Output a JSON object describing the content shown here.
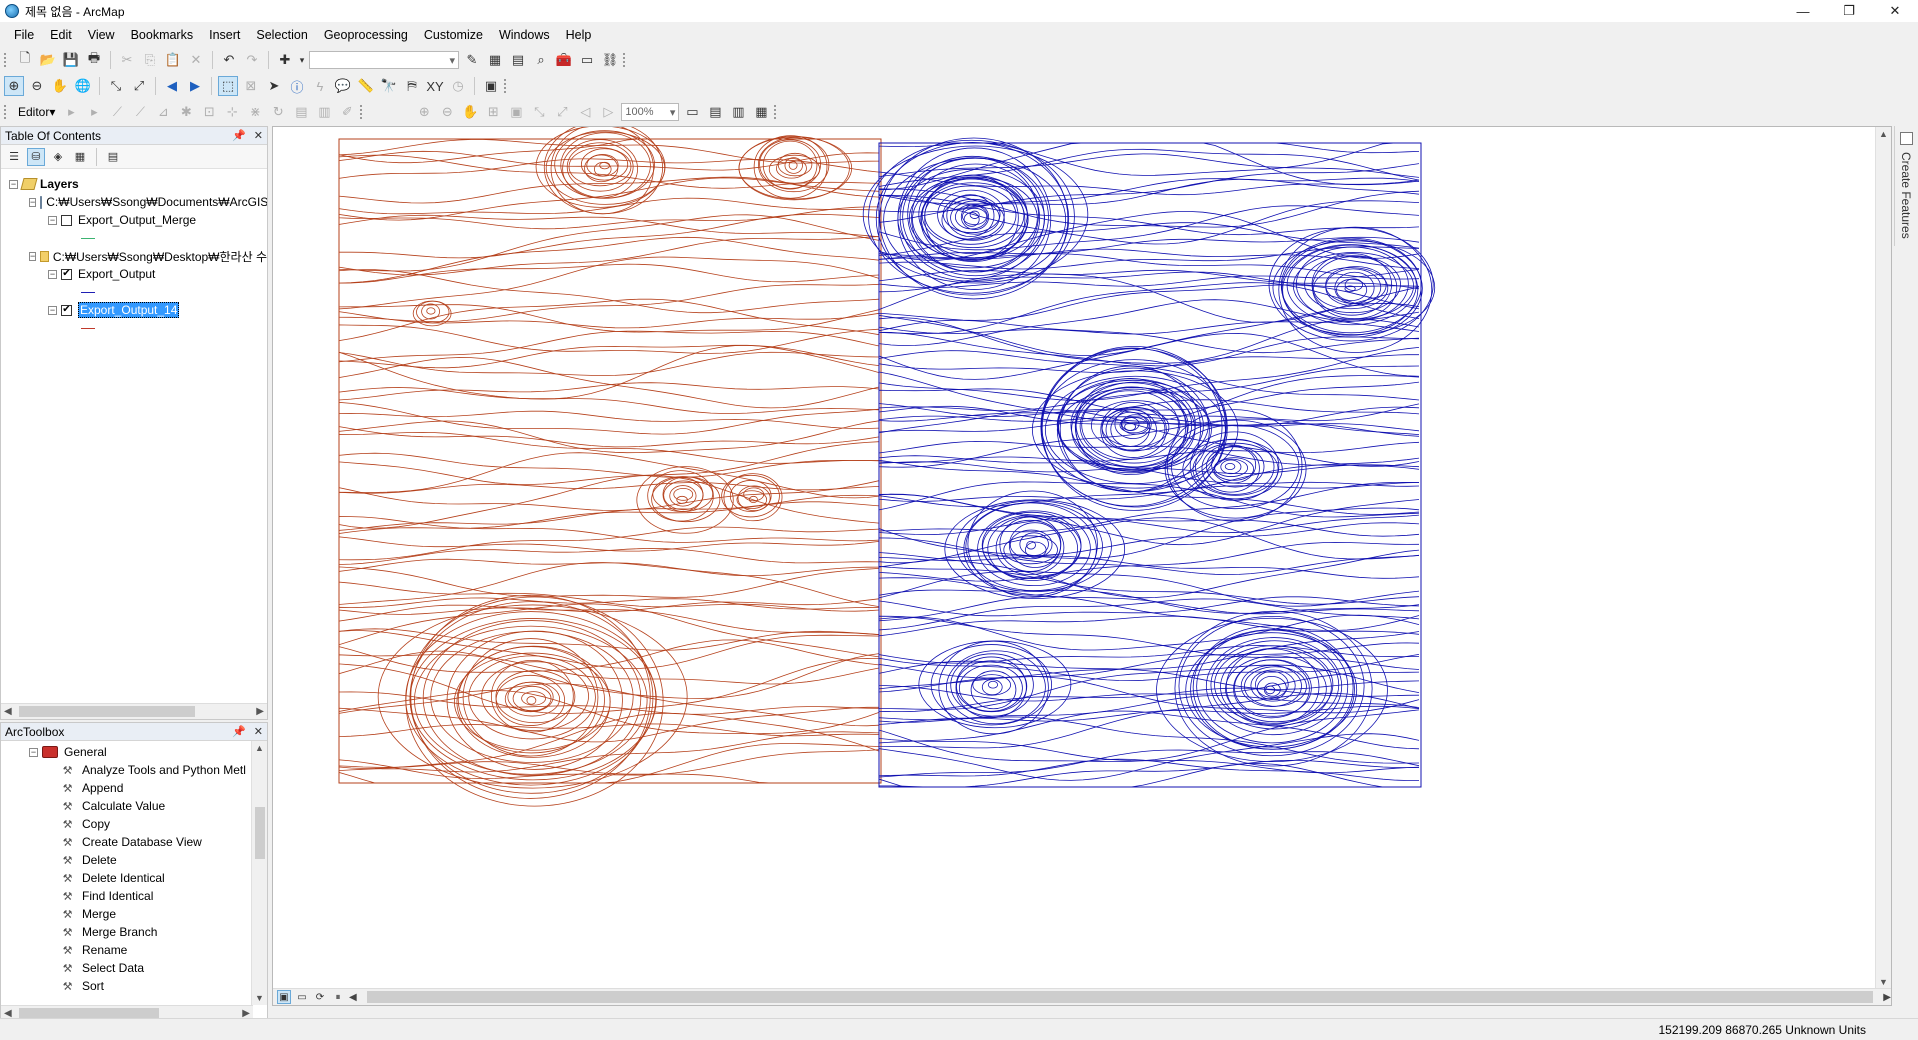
{
  "window": {
    "title": "제목 없음 - ArcMap",
    "controls": [
      "—",
      "❐",
      "✕"
    ]
  },
  "menu": [
    "File",
    "Edit",
    "View",
    "Bookmarks",
    "Insert",
    "Selection",
    "Geoprocessing",
    "Customize",
    "Windows",
    "Help"
  ],
  "toolbars": {
    "scale_placeholder": "",
    "editor_label": "Editor▾",
    "zoom_combo": "100%"
  },
  "toc": {
    "title": "Table Of Contents",
    "root": "Layers",
    "groups": [
      {
        "path": "C:₩Users₩Ssong₩Documents₩ArcGIS",
        "layers": [
          {
            "name": "Export_Output_Merge",
            "checked": false,
            "color": "#3cb371"
          }
        ]
      },
      {
        "path": "C:₩Users₩Ssong₩Desktop₩한라산 수",
        "layers": [
          {
            "name": "Export_Output",
            "checked": true,
            "color": "#1f1fb4"
          },
          {
            "name": "Export_Output_14",
            "checked": true,
            "color": "#c0392b",
            "selected": true
          }
        ]
      }
    ]
  },
  "toolbox": {
    "title": "ArcToolbox",
    "toolset": "General",
    "tools": [
      "Analyze Tools and Python Metl",
      "Append",
      "Calculate Value",
      "Copy",
      "Create Database View",
      "Delete",
      "Delete Identical",
      "Find Identical",
      "Merge",
      "Merge Branch",
      "Rename",
      "Select Data",
      "Sort"
    ]
  },
  "side_tab": {
    "label": "Create Features"
  },
  "status": {
    "coords": "152199.209  86870.265 Unknown Units"
  },
  "colors": {
    "left_layer": "#b5401b",
    "right_layer": "#1010b0",
    "selection": "#3399ff"
  }
}
